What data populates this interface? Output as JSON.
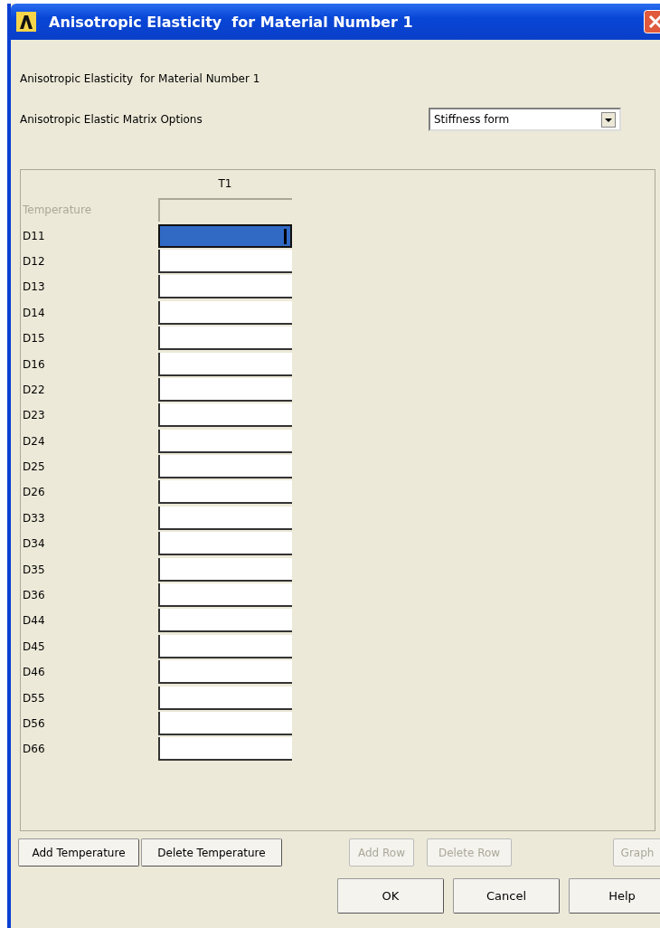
{
  "window": {
    "title": "Anisotropic Elasticity  for Material Number 1"
  },
  "heading": "Anisotropic Elasticity  for Material Number 1",
  "option": {
    "label": "Anisotropic Elastic Matrix Options",
    "value": "Stiffness form"
  },
  "table": {
    "column": "T1",
    "rows": [
      {
        "label": "Temperature",
        "disabled": true,
        "selected": false
      },
      {
        "label": "D11",
        "disabled": false,
        "selected": true
      },
      {
        "label": "D12",
        "disabled": false,
        "selected": false
      },
      {
        "label": "D13",
        "disabled": false,
        "selected": false
      },
      {
        "label": "D14",
        "disabled": false,
        "selected": false
      },
      {
        "label": "D15",
        "disabled": false,
        "selected": false
      },
      {
        "label": "D16",
        "disabled": false,
        "selected": false
      },
      {
        "label": "D22",
        "disabled": false,
        "selected": false
      },
      {
        "label": "D23",
        "disabled": false,
        "selected": false
      },
      {
        "label": "D24",
        "disabled": false,
        "selected": false
      },
      {
        "label": "D25",
        "disabled": false,
        "selected": false
      },
      {
        "label": "D26",
        "disabled": false,
        "selected": false
      },
      {
        "label": "D33",
        "disabled": false,
        "selected": false
      },
      {
        "label": "D34",
        "disabled": false,
        "selected": false
      },
      {
        "label": "D35",
        "disabled": false,
        "selected": false
      },
      {
        "label": "D36",
        "disabled": false,
        "selected": false
      },
      {
        "label": "D44",
        "disabled": false,
        "selected": false
      },
      {
        "label": "D45",
        "disabled": false,
        "selected": false
      },
      {
        "label": "D46",
        "disabled": false,
        "selected": false
      },
      {
        "label": "D55",
        "disabled": false,
        "selected": false
      },
      {
        "label": "D56",
        "disabled": false,
        "selected": false
      },
      {
        "label": "D66",
        "disabled": false,
        "selected": false
      }
    ]
  },
  "table_buttons": [
    {
      "label": "Add Temperature",
      "disabled": false
    },
    {
      "label": "Delete Temperature",
      "disabled": false
    },
    {
      "label": "Add Row",
      "disabled": true
    },
    {
      "label": "Delete Row",
      "disabled": true
    },
    {
      "label": "Graph",
      "disabled": true
    }
  ],
  "buttons": [
    "OK",
    "Cancel",
    "Help"
  ]
}
